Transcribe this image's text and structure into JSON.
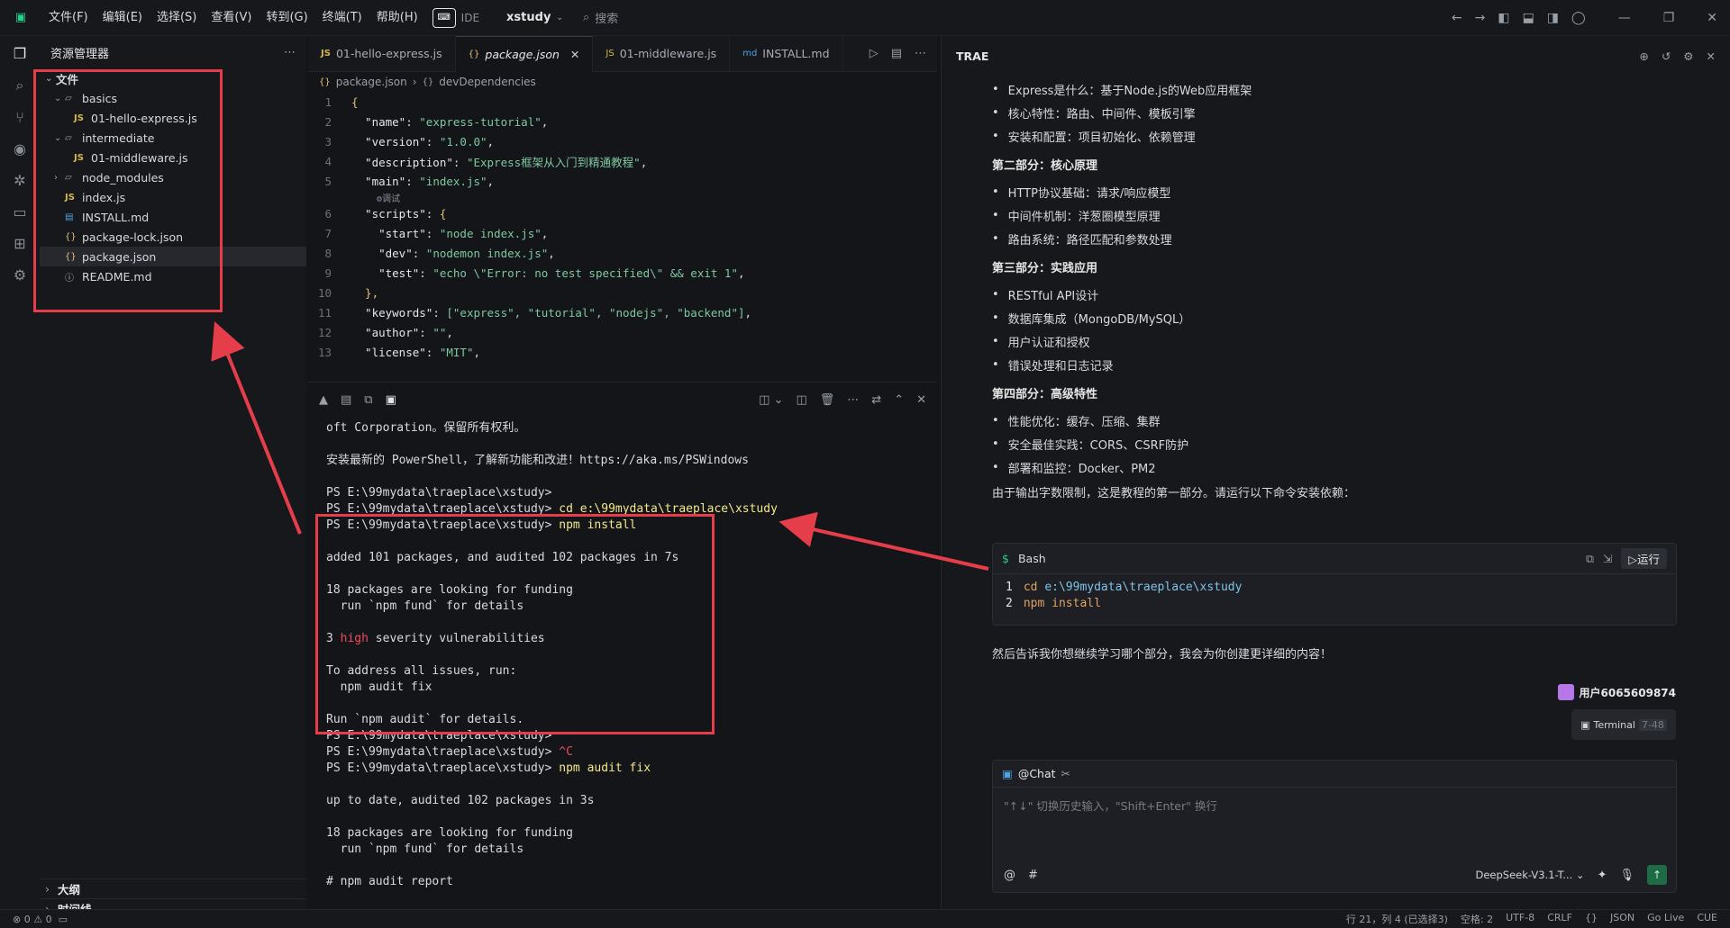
{
  "titlebar": {
    "menu": [
      "文件(F)",
      "编辑(E)",
      "选择(S)",
      "查看(V)",
      "转到(G)",
      "终端(T)",
      "帮助(H)"
    ],
    "ide_label": "IDE",
    "project": "xstudy",
    "search_label": "搜索"
  },
  "explorer": {
    "title": "资源管理器",
    "root": "文件",
    "items": [
      {
        "name": "basics",
        "type": "folder",
        "depth": 1
      },
      {
        "name": "01-hello-express.js",
        "type": "js",
        "depth": 2
      },
      {
        "name": "intermediate",
        "type": "folder",
        "depth": 1
      },
      {
        "name": "01-middleware.js",
        "type": "js",
        "depth": 2
      },
      {
        "name": "node_modules",
        "type": "folder-closed",
        "depth": 1
      },
      {
        "name": "index.js",
        "type": "js",
        "depth": 1
      },
      {
        "name": "INSTALL.md",
        "type": "md",
        "depth": 1
      },
      {
        "name": "package-lock.json",
        "type": "json",
        "depth": 1
      },
      {
        "name": "package.json",
        "type": "json",
        "depth": 1,
        "selected": true
      },
      {
        "name": "README.md",
        "type": "info",
        "depth": 1
      }
    ],
    "outline": "大纲",
    "timeline": "时间线"
  },
  "editor": {
    "tabs": [
      {
        "label": "01-hello-express.js",
        "icon": "JS"
      },
      {
        "label": "package.json",
        "icon": "{}",
        "active": true
      },
      {
        "label": "01-middleware.js",
        "icon": "JS"
      },
      {
        "label": "INSTALL.md",
        "icon": "md"
      }
    ],
    "breadcrumb": [
      "package.json",
      "devDependencies"
    ],
    "codelens": "调试",
    "lines": [
      {
        "n": "1",
        "text": "{"
      },
      {
        "n": "2",
        "key": "\"name\"",
        "val": "\"express-tutorial\""
      },
      {
        "n": "3",
        "key": "\"version\"",
        "val": "\"1.0.0\""
      },
      {
        "n": "4",
        "key": "\"description\"",
        "val": "\"Express框架从入门到精通教程\""
      },
      {
        "n": "5",
        "key": "\"main\"",
        "val": "\"index.js\""
      },
      {
        "n": "6",
        "key": "\"scripts\"",
        "val": "{"
      },
      {
        "n": "7",
        "key": "\"start\"",
        "val": "\"node index.js\""
      },
      {
        "n": "8",
        "key": "\"dev\"",
        "val": "\"nodemon index.js\""
      },
      {
        "n": "9",
        "key": "\"test\"",
        "val": "\"echo \\\"Error: no test specified\\\" && exit 1\""
      },
      {
        "n": "10",
        "text": "},"
      },
      {
        "n": "11",
        "key": "\"keywords\"",
        "val": "[\"express\", \"tutorial\", \"nodejs\", \"backend\"]"
      },
      {
        "n": "12",
        "key": "\"author\"",
        "val": "\"\""
      },
      {
        "n": "13",
        "key": "\"license\"",
        "val": "\"MIT\""
      }
    ]
  },
  "terminal": {
    "lines": [
      {
        "t": "oft Corporation。保留所有权利。"
      },
      {
        "t": ""
      },
      {
        "t": "安装最新的 PowerShell，了解新功能和改进！https://aka.ms/PSWindows"
      },
      {
        "t": ""
      },
      {
        "t": "PS E:\\99mydata\\traeplace\\xstudy>"
      },
      {
        "t": "PS E:\\99mydata\\traeplace\\xstudy> ",
        "cmd": "cd e:\\99mydata\\traeplace\\xstudy"
      },
      {
        "t": "PS E:\\99mydata\\traeplace\\xstudy> ",
        "cmd": "npm install"
      },
      {
        "t": ""
      },
      {
        "t": "added 101 packages, and audited 102 packages in 7s"
      },
      {
        "t": ""
      },
      {
        "t": "18 packages are looking for funding"
      },
      {
        "t": "  run `npm fund` for details"
      },
      {
        "t": ""
      },
      {
        "t": "3 ",
        "red": "high",
        "rest": " severity vulnerabilities"
      },
      {
        "t": ""
      },
      {
        "t": "To address all issues, run:"
      },
      {
        "t": "  npm audit fix"
      },
      {
        "t": ""
      },
      {
        "t": "Run `npm audit` for details."
      },
      {
        "t": "PS E:\\99mydata\\traeplace\\xstudy>"
      },
      {
        "t": "PS E:\\99mydata\\traeplace\\xstudy> ",
        "red": "^C"
      },
      {
        "t": "PS E:\\99mydata\\traeplace\\xstudy> ",
        "cmd": "npm audit fix"
      },
      {
        "t": ""
      },
      {
        "t": "up to date, audited 102 packages in 3s"
      },
      {
        "t": ""
      },
      {
        "t": "18 packages are looking for funding"
      },
      {
        "t": "  run `npm fund` for details"
      },
      {
        "t": ""
      },
      {
        "t": "# npm audit report"
      }
    ]
  },
  "ai_panel": {
    "title": "TRAE",
    "intro_bullets": [
      "Express是什么：基于Node.js的Web应用框架",
      "核心特性：路由、中间件、模板引擎",
      "安装和配置：项目初始化、依赖管理"
    ],
    "sections": [
      {
        "title": "第二部分：核心原理",
        "bullets": [
          "HTTP协议基础：请求/响应模型",
          "中间件机制：洋葱圈模型原理",
          "路由系统：路径匹配和参数处理"
        ]
      },
      {
        "title": "第三部分：实践应用",
        "bullets": [
          "RESTful API设计",
          "数据库集成（MongoDB/MySQL）",
          "用户认证和授权",
          "错误处理和日志记录"
        ]
      },
      {
        "title": "第四部分：高级特性",
        "bullets": [
          "性能优化：缓存、压缩、集群",
          "安全最佳实践：CORS、CSRF防护",
          "部署和监控：Docker、PM2"
        ]
      }
    ],
    "note": "由于输出字数限制，这是教程的第一部分。请运行以下命令安装依赖：",
    "codeblock": {
      "lang": "Bash",
      "run_label": "运行",
      "lines": [
        {
          "n": "1",
          "cmd": "cd",
          "arg": "e:\\99mydata\\traeplace\\xstudy"
        },
        {
          "n": "2",
          "cmd": "npm",
          "arg": "install"
        }
      ]
    },
    "closing": "然后告诉我你想继续学习哪个部分，我会为你创建更详细的内容！",
    "user_name": "用户6065609874",
    "terminal_chip": "Terminal",
    "terminal_chip_range": "7-48",
    "chat_label": "@Chat",
    "chat_placeholder": "\"↑↓\" 切换历史输入，\"Shift+Enter\" 换行",
    "model": "DeepSeek-V3.1-T..."
  },
  "statusbar": {
    "errors": "0",
    "warnings": "0",
    "right": [
      "行 21，列 4 (已选择3)",
      "空格: 2",
      "UTF-8",
      "CRLF",
      "{}",
      "JSON",
      "Go Live",
      "CUE"
    ]
  },
  "colors": {
    "accent_red": "#e53e4a",
    "run_green": "#1f6b46"
  }
}
